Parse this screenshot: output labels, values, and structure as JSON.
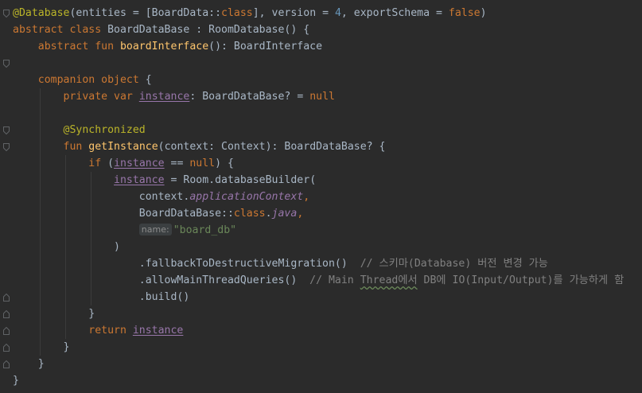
{
  "editor": {
    "lines": [
      {
        "id": "l1",
        "tokens": [
          [
            "ann",
            "@Database"
          ],
          [
            "p",
            "(entities = [BoardData::"
          ],
          [
            "kw",
            "class"
          ],
          [
            "p",
            "], version = "
          ],
          [
            "num",
            "4"
          ],
          [
            "p",
            ", exportSchema = "
          ],
          [
            "kw",
            "false"
          ],
          [
            "p",
            ")"
          ]
        ]
      },
      {
        "id": "l2",
        "tokens": [
          [
            "kw",
            "abstract class "
          ],
          [
            "p",
            "BoardDataBase : RoomDatabase() {"
          ]
        ]
      },
      {
        "id": "l3",
        "tokens": [
          [
            "p",
            "    "
          ],
          [
            "kw",
            "abstract fun "
          ],
          [
            "fn",
            "boardInterface"
          ],
          [
            "p",
            "(): BoardInterface"
          ]
        ]
      },
      {
        "id": "l4",
        "tokens": []
      },
      {
        "id": "l5",
        "tokens": [
          [
            "p",
            "    "
          ],
          [
            "kw",
            "companion object "
          ],
          [
            "p",
            "{"
          ]
        ]
      },
      {
        "id": "l6",
        "tokens": [
          [
            "p",
            "        "
          ],
          [
            "kw",
            "private var "
          ],
          [
            "field",
            "instance"
          ],
          [
            "p",
            ": BoardDataBase? = "
          ],
          [
            "kw",
            "null"
          ]
        ]
      },
      {
        "id": "l7",
        "tokens": []
      },
      {
        "id": "l8",
        "tokens": [
          [
            "p",
            "        "
          ],
          [
            "ann",
            "@Synchronized"
          ]
        ]
      },
      {
        "id": "l9",
        "tokens": [
          [
            "p",
            "        "
          ],
          [
            "kw",
            "fun "
          ],
          [
            "fn",
            "getInstance"
          ],
          [
            "p",
            "(context: Context): BoardDataBase? {"
          ]
        ]
      },
      {
        "id": "l10",
        "tokens": [
          [
            "p",
            "            "
          ],
          [
            "kw",
            "if "
          ],
          [
            "p",
            "("
          ],
          [
            "field",
            "instance"
          ],
          [
            "p",
            " == "
          ],
          [
            "kw",
            "null"
          ],
          [
            "p",
            ") {"
          ]
        ]
      },
      {
        "id": "l11",
        "tokens": [
          [
            "p",
            "                "
          ],
          [
            "field",
            "instance"
          ],
          [
            "p",
            " = Room.databaseBuilder("
          ]
        ]
      },
      {
        "id": "l12",
        "tokens": [
          [
            "p",
            "                    context."
          ],
          [
            "prop",
            "applicationContext"
          ],
          [
            "kw",
            ","
          ]
        ]
      },
      {
        "id": "l13",
        "tokens": [
          [
            "p",
            "                    BoardDataBase::"
          ],
          [
            "kw",
            "class"
          ],
          [
            "p",
            "."
          ],
          [
            "prop",
            "java"
          ],
          [
            "kw",
            ","
          ]
        ]
      },
      {
        "id": "l14",
        "tokens": [
          [
            "p",
            "                    "
          ],
          [
            "hint",
            "name:"
          ],
          [
            "str",
            "\"board_db\""
          ]
        ]
      },
      {
        "id": "l15",
        "tokens": [
          [
            "p",
            "                )"
          ]
        ]
      },
      {
        "id": "l16",
        "tokens": [
          [
            "p",
            "                    .fallbackToDestructiveMigration()  "
          ],
          [
            "cmt",
            "// 스키마(Database) 버전 변경 가능"
          ]
        ]
      },
      {
        "id": "l17",
        "tokens": [
          [
            "p",
            "                    .allowMainThreadQueries()  "
          ],
          [
            "cmt",
            "// Main "
          ],
          [
            "cmttypo",
            "Thread에서"
          ],
          [
            "cmt",
            " DB에 IO(Input/Output)를 가능하게 함"
          ]
        ]
      },
      {
        "id": "l18",
        "tokens": [
          [
            "p",
            "                    .build()"
          ]
        ]
      },
      {
        "id": "l19",
        "tokens": [
          [
            "p",
            "            }"
          ]
        ]
      },
      {
        "id": "l20",
        "tokens": [
          [
            "p",
            "            "
          ],
          [
            "kw",
            "return "
          ],
          [
            "field",
            "instance"
          ]
        ]
      },
      {
        "id": "l21",
        "tokens": [
          [
            "p",
            "        }"
          ]
        ]
      },
      {
        "id": "l22",
        "tokens": [
          [
            "p",
            "    }"
          ]
        ]
      },
      {
        "id": "l23",
        "tokens": [
          [
            "p",
            "}"
          ]
        ]
      }
    ],
    "fold_markers": [
      {
        "line": 1,
        "kind": "open"
      },
      {
        "line": 4,
        "kind": "open"
      },
      {
        "line": 8,
        "kind": "open"
      },
      {
        "line": 9,
        "kind": "open"
      },
      {
        "line": 18,
        "kind": "close"
      },
      {
        "line": 19,
        "kind": "close"
      },
      {
        "line": 20,
        "kind": "close"
      },
      {
        "line": 21,
        "kind": "close"
      },
      {
        "line": 22,
        "kind": "close"
      }
    ]
  }
}
